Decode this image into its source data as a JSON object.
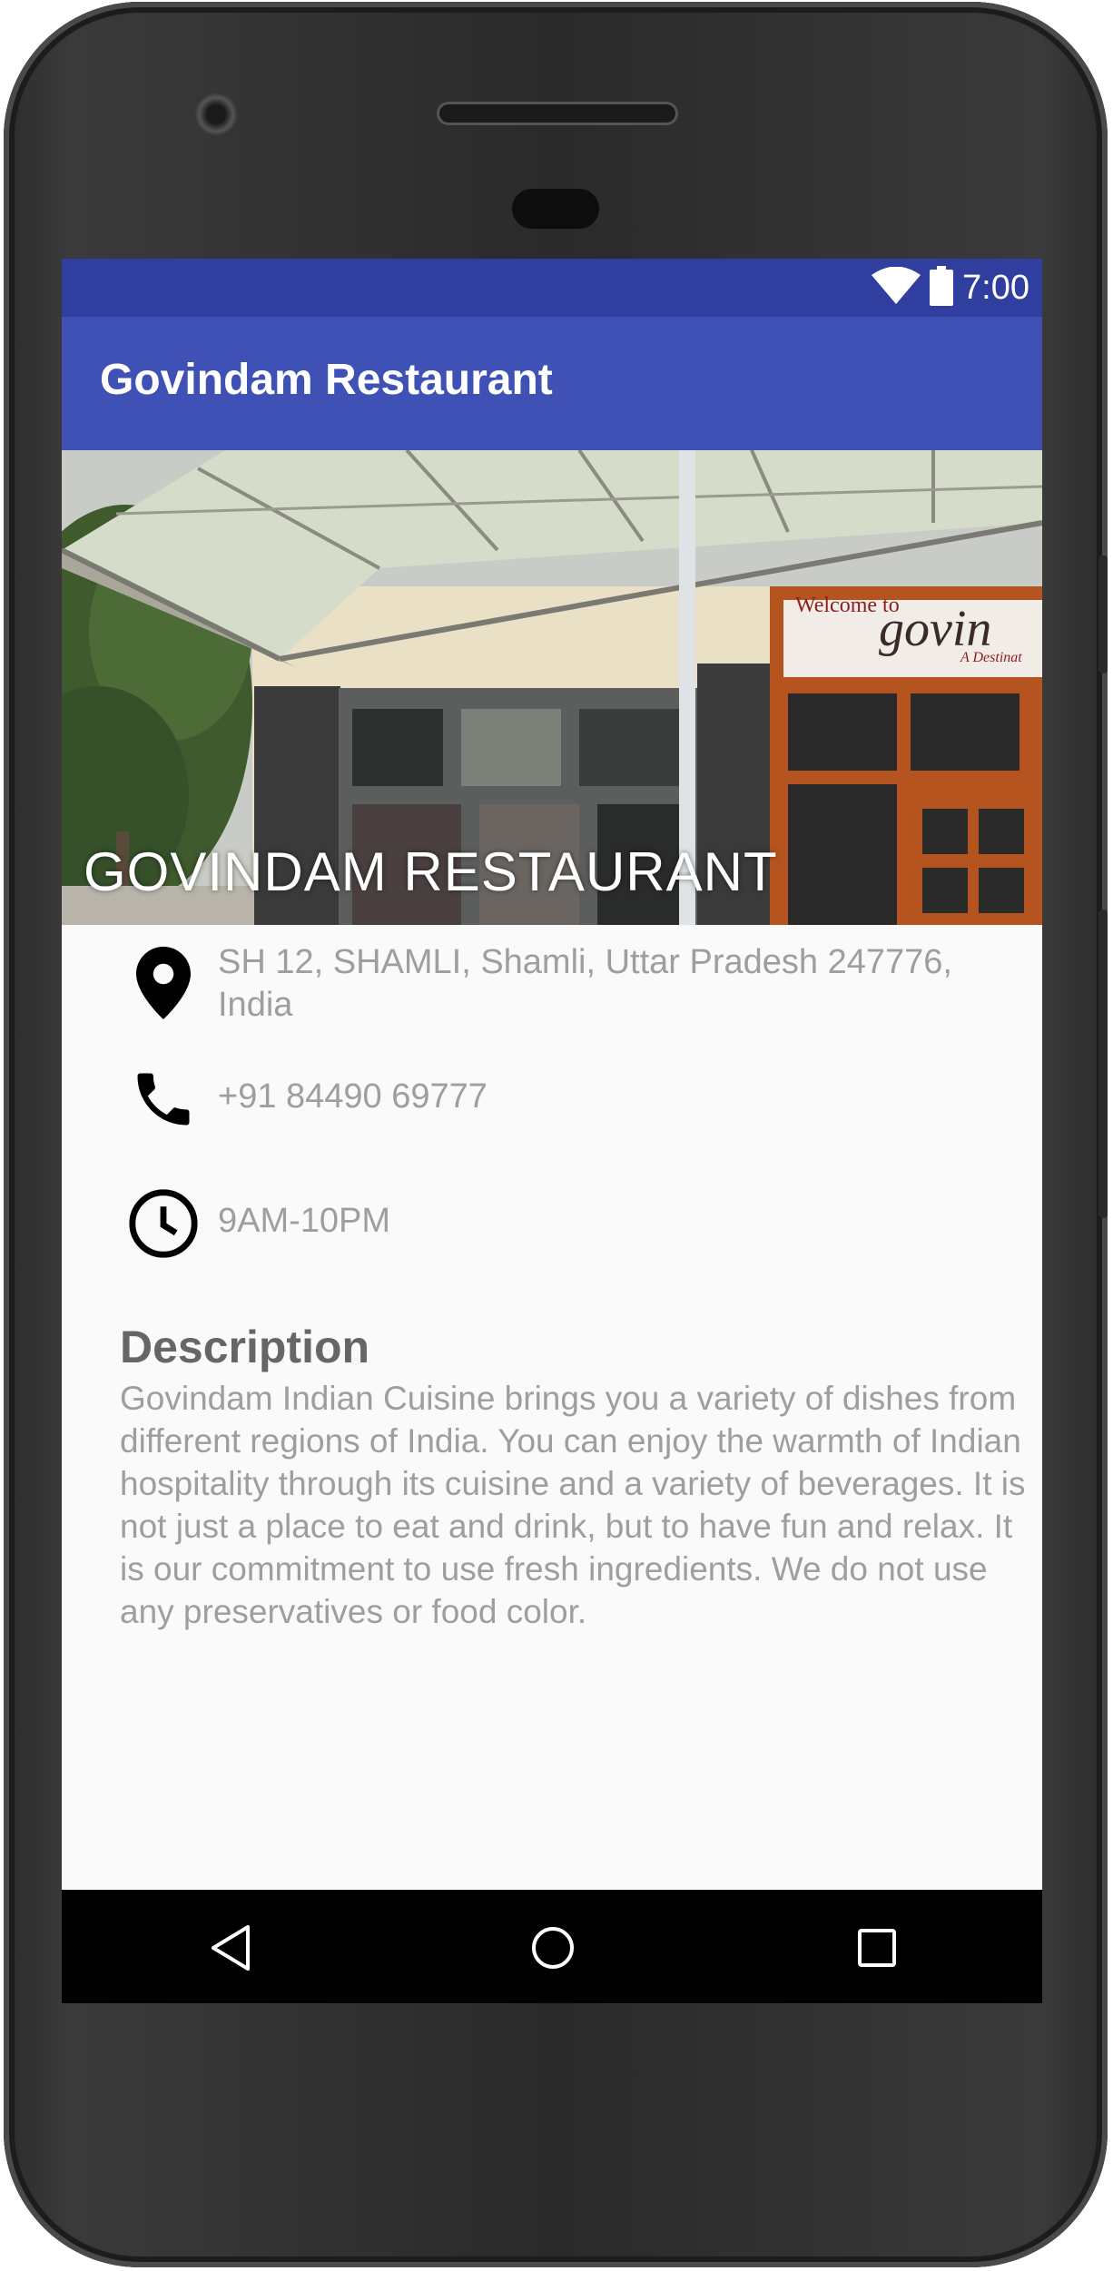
{
  "status_bar": {
    "time": "7:00",
    "icons": [
      "wifi-icon",
      "battery-icon"
    ]
  },
  "app_bar": {
    "title": "Govindam Restaurant"
  },
  "hero": {
    "title": "GOVINDAM RESTAURANT",
    "sign_text": "Welcome to",
    "sign_text_2": "govin",
    "sign_text_3": "A Destinat"
  },
  "details": {
    "address": "SH 12, SHAMLI, Shamli, Uttar Pradesh 247776, India",
    "phone": "+91 84490 69777",
    "hours": "9AM-10PM"
  },
  "description": {
    "title": "Description",
    "body": "Govindam Indian Cuisine brings you a variety of dishes from different regions of India. You can enjoy the warmth of Indian hospitality through its cuisine and a variety of beverages. It is not just a place to eat and drink, but to have fun and relax. It is our commitment to use fresh ingredients. We do not use any preservatives or food color."
  },
  "nav_bar": {
    "buttons": [
      "back-icon",
      "home-icon",
      "recents-icon"
    ]
  },
  "colors": {
    "status_bar": "#303f9f",
    "app_bar": "#3f51b5",
    "text_secondary": "#9e9e9e",
    "heading": "#666666"
  }
}
